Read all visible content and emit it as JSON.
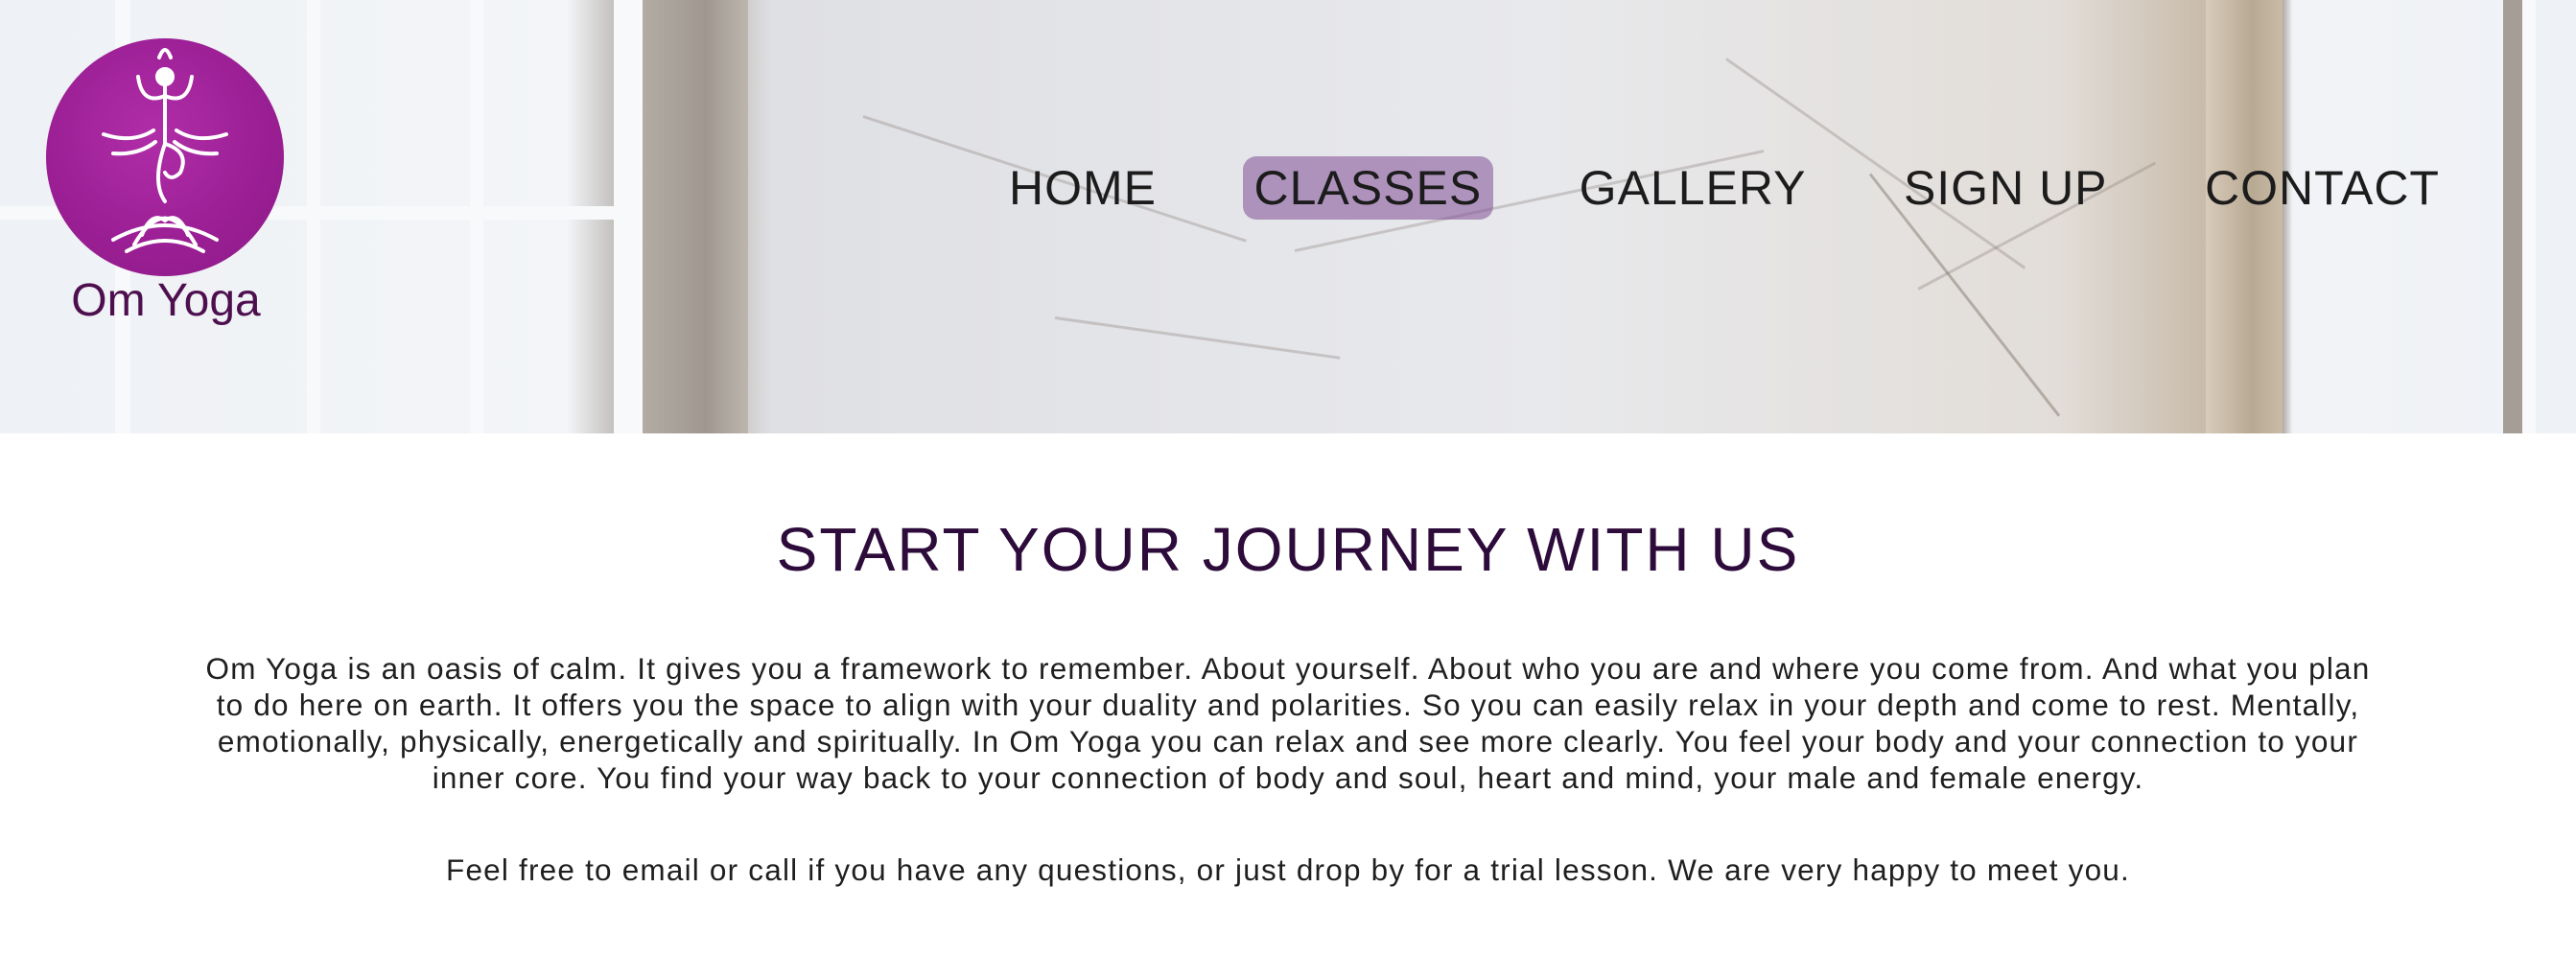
{
  "brand": {
    "name": "Om Yoga",
    "logo_color": "#9c1f95",
    "logo_icon": "yoga-lotus-icon"
  },
  "nav": {
    "items": [
      {
        "label": "HOME"
      },
      {
        "label": "CLASSES",
        "active": true
      },
      {
        "label": "GALLERY"
      },
      {
        "label": "SIGN UP"
      },
      {
        "label": "CONTACT"
      }
    ],
    "active_color": "#9b73ad"
  },
  "main": {
    "heading": "START YOUR JOURNEY WITH US",
    "paragraphs": [
      "Om Yoga is an oasis of calm. It gives you a framework to remember. About yourself. About who you are and where you come from. And what you plan to do here on earth. It offers you the space to align with your duality and polarities. So you can easily relax in your depth and come to rest. Mentally, emotionally, physically, energetically and spiritually. In Om Yoga you can relax and see more clearly. You feel your body and your connection to your inner core. You find your way back to your connection of body and soul, heart and mind, your male and female energy.",
      "Feel free to email or call if you have any questions, or just drop by for a trial lesson. We are very happy to meet you."
    ],
    "heading_color": "#2d0b3a"
  }
}
